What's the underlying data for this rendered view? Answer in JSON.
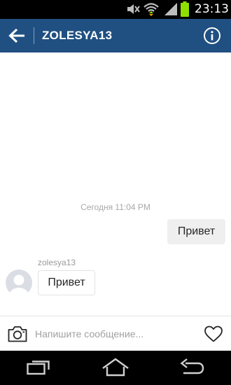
{
  "status_bar": {
    "time": "23:13",
    "icons": [
      "mute-icon",
      "wifi-icon",
      "signal-icon",
      "battery-icon"
    ],
    "battery_color": "#8ee000"
  },
  "app_bar": {
    "title": "ZOLESYA13",
    "background": "#205081",
    "back_icon": "arrow-left-icon",
    "info_icon": "info-circle-icon"
  },
  "conversation": {
    "timestamp": "Сегодня 11:04 PM",
    "messages": [
      {
        "direction": "outgoing",
        "text": "Привет"
      },
      {
        "direction": "incoming",
        "sender": "zolesya13",
        "text": "Привет",
        "avatar": "default-avatar-icon"
      }
    ]
  },
  "composer": {
    "placeholder": "Напишите сообщение...",
    "value": "",
    "camera_icon": "camera-icon",
    "like_icon": "heart-icon"
  },
  "nav_bar": {
    "buttons": [
      "recent-apps-icon",
      "home-icon",
      "back-icon"
    ]
  }
}
